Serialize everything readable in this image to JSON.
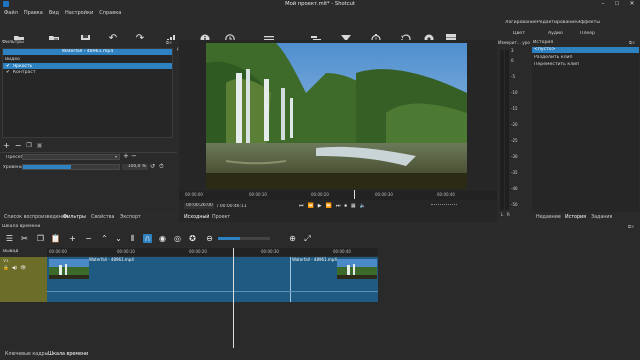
{
  "window": {
    "title": "Мой проект.mlt* - Shotcut"
  },
  "menu": [
    "Файл",
    "Правка",
    "Вид",
    "Настройки",
    "Справка"
  ],
  "toolbar": [
    {
      "label": "Открыть файл",
      "icon": "folder-icon"
    },
    {
      "label": "Открыть другой",
      "icon": "open-other-icon"
    },
    {
      "label": "Сохранить",
      "icon": "save-icon"
    },
    {
      "label": "Отменить",
      "icon": "undo-icon"
    },
    {
      "label": "Повторить",
      "icon": "redo-icon"
    },
    {
      "label": "Измерить уровни",
      "icon": "levels-icon"
    },
    {
      "label": "Свойства",
      "icon": "info-icon"
    },
    {
      "label": "Недавние",
      "icon": "recent-icon"
    },
    {
      "label": "Список воспроизведения",
      "icon": "playlist-icon"
    },
    {
      "label": "Шкала времени",
      "icon": "timeline-icon"
    },
    {
      "label": "Фильтры",
      "icon": "filter-icon"
    },
    {
      "label": "Ключевые кадры",
      "icon": "stopwatch-icon"
    },
    {
      "label": "История",
      "icon": "history-icon"
    },
    {
      "label": "Экспорт",
      "icon": "export-icon"
    },
    {
      "label": "Задания",
      "icon": "jobs-icon"
    }
  ],
  "layouts": {
    "top": [
      "Логирование",
      "Редактирование",
      "Эффекты"
    ],
    "bottom": [
      "Цвет",
      "Аудио",
      "Плеер"
    ]
  },
  "filters": {
    "panel_title": "Фильтры",
    "clip_name": "Waterfall - 48961.mp4",
    "section": "Видео",
    "items": [
      {
        "label": "Яркость",
        "checked": "✔"
      },
      {
        "label": "Контраст",
        "checked": "✔"
      }
    ],
    "preset_label": "Пресет",
    "level_label": "Уровень",
    "level_value": "100,0 %",
    "level_fraction": 0.5
  },
  "left_tabs": [
    "Список воспроизведения",
    "Фильтры",
    "Свойства",
    "Экспорт"
  ],
  "player": {
    "ruler": [
      "00:00:00",
      "00:00:10",
      "00:00:20",
      "00:00:30",
      "00:00:40"
    ],
    "position": "00:00:26:00",
    "duration": "/ 00:00:46:11",
    "tabs": [
      "Исходный",
      "Проект"
    ]
  },
  "audio_meter": {
    "title": "Измерит... уровня",
    "scale": [
      "3",
      "0",
      "-5",
      "-10",
      "-15",
      "-20",
      "-25",
      "-30",
      "-35",
      "-40",
      "-50"
    ],
    "channels": "L   R"
  },
  "history": {
    "title": "История",
    "items": [
      "<пусто>",
      "Разделить клип",
      "Переместить клип"
    ],
    "tabs": [
      "Недавние",
      "История",
      "Задания"
    ]
  },
  "timeline": {
    "panel_title": "Шкала времени",
    "output_label": "Вывод",
    "track_label": "V1",
    "ruler": [
      "00:00:00",
      "00:00:10",
      "00:00:20",
      "00:00:30",
      "00:00:40"
    ],
    "clip_a": "Waterfall - 48961.mp4",
    "clip_b": "Waterfall - 48961.mp4"
  },
  "bottom_tabs": [
    "Ключевые кадры",
    "Шкала времени"
  ],
  "colors": {
    "accent": "#2e82c2",
    "track_output": "#6d6d2a",
    "clip": "#1f5a82"
  }
}
